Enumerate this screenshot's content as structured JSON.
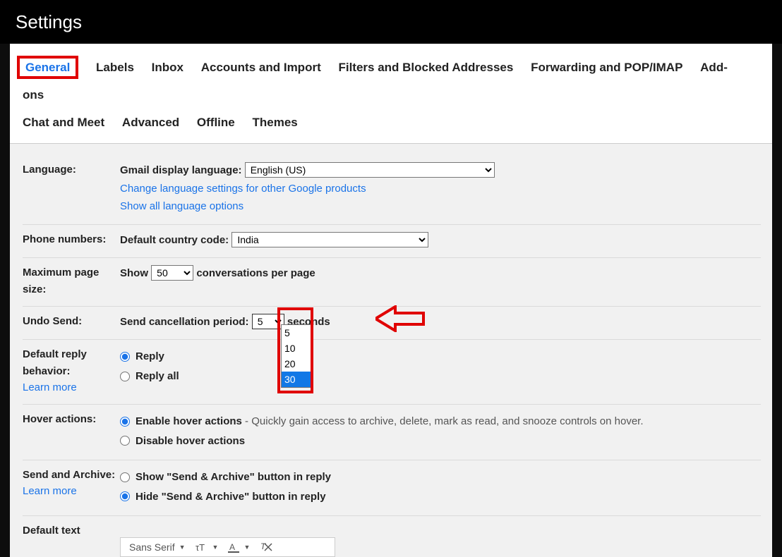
{
  "header": {
    "title": "Settings"
  },
  "tabs": {
    "row1": [
      "General",
      "Labels",
      "Inbox",
      "Accounts and Import",
      "Filters and Blocked Addresses",
      "Forwarding and POP/IMAP",
      "Add-ons"
    ],
    "row2": [
      "Chat and Meet",
      "Advanced",
      "Offline",
      "Themes"
    ],
    "active": "General"
  },
  "language": {
    "label": "Language:",
    "display_label": "Gmail display language:",
    "selected": "English (US)",
    "link1": "Change language settings for other Google products",
    "link2": "Show all language options"
  },
  "phone": {
    "label": "Phone numbers:",
    "code_label": "Default country code:",
    "selected": "India"
  },
  "pagesize": {
    "label": "Maximum page size:",
    "prefix": "Show",
    "selected": "50",
    "suffix": "conversations per page"
  },
  "undo": {
    "label": "Undo Send:",
    "text": "Send cancellation period:",
    "selected": "5",
    "suffix": "seconds",
    "options": [
      "5",
      "10",
      "20",
      "30"
    ],
    "highlighted": "30"
  },
  "reply": {
    "label": "Default reply behavior:",
    "learn_more": "Learn more",
    "opt1": "Reply",
    "opt2": "Reply all"
  },
  "hover": {
    "label": "Hover actions:",
    "opt1_bold": "Enable hover actions",
    "opt1_rest": " - Quickly gain access to archive, delete, mark as read, and snooze controls on hover.",
    "opt2": "Disable hover actions"
  },
  "sendarchive": {
    "label": "Send and Archive:",
    "learn_more": "Learn more",
    "opt1": "Show \"Send & Archive\" button in reply",
    "opt2": "Hide \"Send & Archive\" button in reply"
  },
  "defaulttext": {
    "label": "Default text",
    "font": "Sans Serif"
  }
}
